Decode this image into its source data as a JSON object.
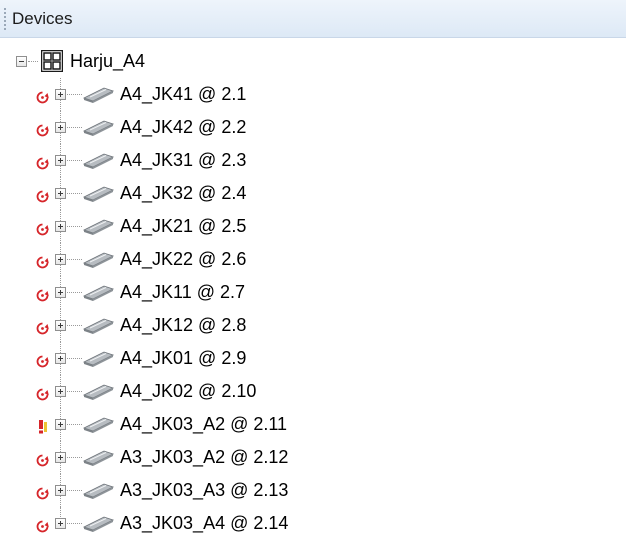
{
  "panel": {
    "title": "Devices"
  },
  "root": {
    "label": "Harju_A4",
    "expanded": true,
    "icon": "group-grid-icon"
  },
  "devices": [
    {
      "label": "A4_JK41 @ 2.1",
      "status": "sync-error-icon"
    },
    {
      "label": "A4_JK42 @ 2.2",
      "status": "sync-error-icon"
    },
    {
      "label": "A4_JK31 @ 2.3",
      "status": "sync-error-icon"
    },
    {
      "label": "A4_JK32 @ 2.4",
      "status": "sync-error-icon"
    },
    {
      "label": "A4_JK21 @ 2.5",
      "status": "sync-error-icon"
    },
    {
      "label": "A4_JK22 @ 2.6",
      "status": "sync-error-icon"
    },
    {
      "label": "A4_JK11 @ 2.7",
      "status": "sync-error-icon"
    },
    {
      "label": "A4_JK12 @ 2.8",
      "status": "sync-error-icon"
    },
    {
      "label": "A4_JK01 @ 2.9",
      "status": "sync-error-icon"
    },
    {
      "label": "A4_JK02 @ 2.10",
      "status": "sync-error-icon"
    },
    {
      "label": "A4_JK03_A2 @ 2.11",
      "status": "warning-icon"
    },
    {
      "label": "A3_JK03_A2 @ 2.12",
      "status": "sync-error-icon"
    },
    {
      "label": "A3_JK03_A3 @ 2.13",
      "status": "sync-error-icon"
    },
    {
      "label": "A3_JK03_A4 @ 2.14",
      "status": "sync-error-icon"
    }
  ],
  "colors": {
    "sync_error": "#d6252a",
    "warning": "#e8b400",
    "warning_bang": "#d6252a",
    "device_body": "#9aa0a6"
  }
}
